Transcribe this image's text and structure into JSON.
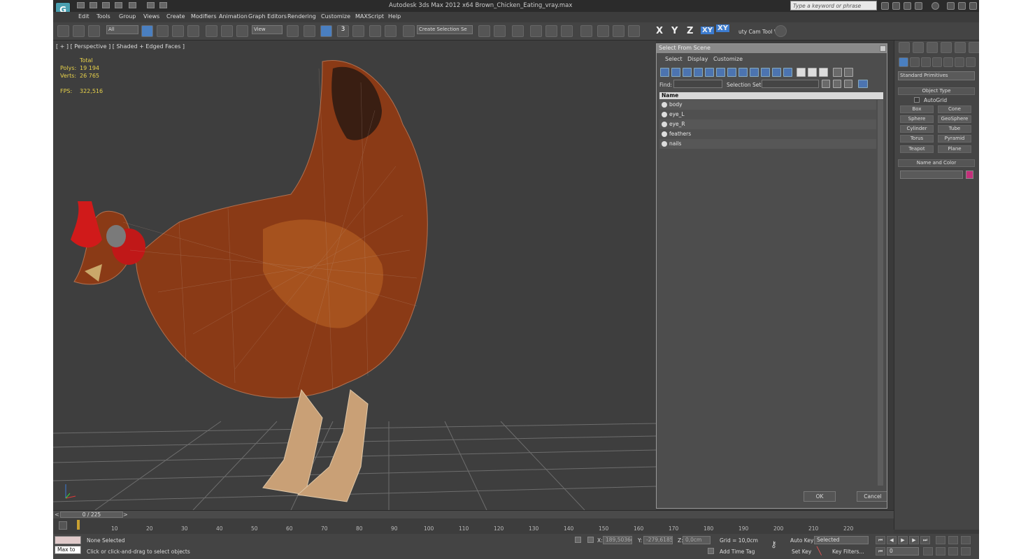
{
  "window": {
    "title": "Autodesk 3ds Max  2012 x64     Brown_Chicken_Eating_vray.max",
    "search_placeholder": "Type a keyword or phrase"
  },
  "menu": [
    "Edit",
    "Tools",
    "Group",
    "Views",
    "Create",
    "Modifiers",
    "Animation",
    "Graph Editors",
    "Rendering",
    "Customize",
    "MAXScript",
    "Help"
  ],
  "toolbar": {
    "filter_value": "All",
    "refcoord_value": "View",
    "snap3": "3",
    "selection_set": "Create Selection Se",
    "axes": [
      "X",
      "Y",
      "Z",
      "XY",
      "XY"
    ],
    "camtool": "uty Cam Tool \\"
  },
  "viewport": {
    "label": "[ + ] [ Perspective ] [ Shaded + Edged Faces ]",
    "stats": {
      "total_label": "Total",
      "polys_label": "Polys:",
      "polys": "19 194",
      "verts_label": "Verts:",
      "verts": "26 765",
      "fps_label": "FPS:",
      "fps": "322,516"
    }
  },
  "dialog": {
    "title": "Select From Scene",
    "menu": [
      "Select",
      "Display",
      "Customize"
    ],
    "find_label": "Find:",
    "selset_label": "Selection Set:",
    "column_name": "Name",
    "items": [
      "body",
      "eye_L",
      "eye_R",
      "feathers",
      "nails"
    ],
    "ok": "OK",
    "cancel": "Cancel"
  },
  "cmdpanel": {
    "category": "Standard Primitives",
    "object_type_header": "Object Type",
    "autogrid": "AutoGrid",
    "buttons": [
      "Box",
      "Cone",
      "Sphere",
      "GeoSphere",
      "Cylinder",
      "Tube",
      "Torus",
      "Pyramid",
      "Teapot",
      "Plane"
    ],
    "name_color_header": "Name and Color",
    "swatch_color": "#c3307a"
  },
  "timeline": {
    "frame_label": "0 / 225",
    "ticks": [
      "10",
      "20",
      "30",
      "40",
      "50",
      "60",
      "70",
      "80",
      "90",
      "100",
      "110",
      "120",
      "130",
      "140",
      "150",
      "160",
      "170",
      "180",
      "190",
      "200",
      "210",
      "220"
    ]
  },
  "status": {
    "maxscript_prompt": "Max to",
    "selection": "None Selected",
    "prompt": "Click or click-and-drag to select objects",
    "x_label": "X:",
    "x_value": "189,5036c",
    "y_label": "Y:",
    "y_value": "-279,6185c",
    "z_label": "Z:",
    "z_value": "0,0cm",
    "grid": "Grid = 10,0cm",
    "add_time_tag": "Add Time Tag",
    "auto_key": "Auto Key",
    "set_key": "Set Key",
    "selected_value": "Selected",
    "key_filters": "Key Filters...",
    "frame_value": "0"
  }
}
